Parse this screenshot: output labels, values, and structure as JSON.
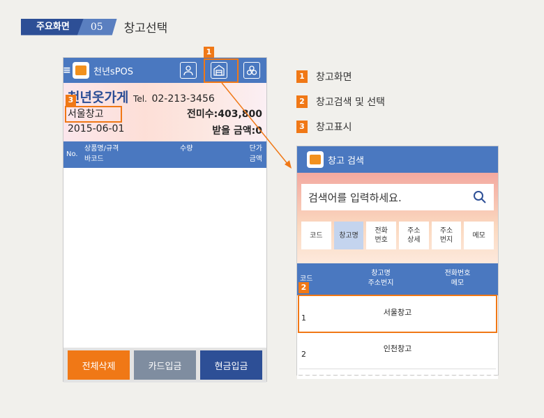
{
  "header": {
    "tag": "주요화면",
    "number": "05",
    "title": "창고선택"
  },
  "phone": {
    "app_title": "천년sPOS",
    "store_name": "천년옷가게",
    "tel_label": "Tel.",
    "tel": "02-213-3456",
    "warehouse": "서울창고",
    "unpaid": "전미수:403,800",
    "date": "2015-06-01",
    "receivable": "받을 금액:0",
    "table": {
      "no": "No.",
      "item_line1": "상품명/규격",
      "item_line2": "바코드",
      "qty": "수량",
      "price_line1": "단가",
      "price_line2": "금액"
    },
    "buttons": [
      "전체삭제",
      "카드입금",
      "현금입금"
    ]
  },
  "legend": [
    {
      "num": "1",
      "text": "창고화면"
    },
    {
      "num": "2",
      "text": "창고검색 및 선택"
    },
    {
      "num": "3",
      "text": "창고표시"
    }
  ],
  "search_panel": {
    "title": "창고 검색",
    "placeholder": "검색어를 입력하세요.",
    "tabs": [
      "코드",
      "창고명",
      "전화\n번호",
      "주소\n상세",
      "주소\n번지",
      "메모"
    ],
    "active_tab": 1,
    "columns": {
      "code": "코드",
      "name_line1": "창고명",
      "name_line2": "주소번지",
      "phone_line1": "전화번호",
      "phone_line2": "메모"
    },
    "rows": [
      {
        "code": "1",
        "name": "서울창고"
      },
      {
        "code": "2",
        "name": "인천창고"
      }
    ]
  },
  "colors": {
    "accent": "#f07816",
    "primary": "#4a78c0",
    "orange_btn": "#f07816",
    "gray_btn": "#7f8da0",
    "blue_btn": "#2d4f96"
  }
}
